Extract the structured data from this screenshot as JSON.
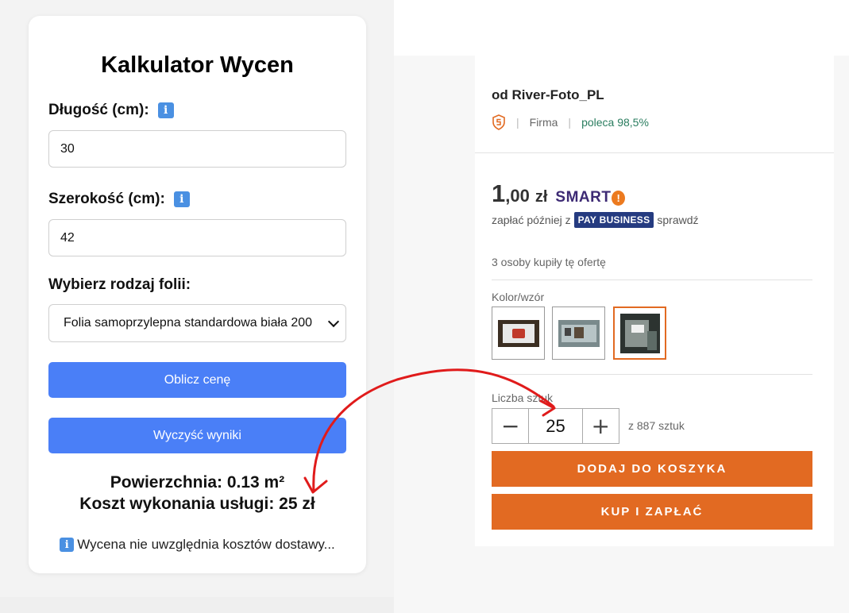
{
  "calculator": {
    "title": "Kalkulator Wycen",
    "length_label": "Długość (cm):",
    "length_value": "30",
    "width_label": "Szerokość (cm):",
    "width_value": "42",
    "film_label": "Wybierz rodzaj folii:",
    "film_selected": "Folia samoprzylepna standardowa biała 200",
    "calc_button": "Oblicz cenę",
    "clear_button": "Wyczyść wyniki",
    "result_area": "Powierzchnia: 0.13 m²",
    "result_cost": "Koszt wykonania usługi: 25 zł",
    "note": "Wycena nie uwzględnia kosztów dostawy...",
    "info_glyph": "i"
  },
  "offer": {
    "seller": "od River-Foto_PL",
    "seller_type": "Firma",
    "recommend": "poleca 98,5%",
    "price_int": "1",
    "price_dec": ",00",
    "currency": "zł",
    "smart_label": "SMART",
    "smart_glyph": "!",
    "paylater_prefix": "zapłać później z",
    "pay_badge": "PAY BUSINESS",
    "paylater_suffix": "sprawdź",
    "bought_count": "3 osoby kupiły tę ofertę",
    "color_label": "Kolor/wzór",
    "qty_label": "Liczba sztuk",
    "qty_minus": "−",
    "qty_value": "25",
    "qty_plus": "+",
    "stock": "z 887 sztuk",
    "add_to_cart": "DODAJ DO KOSZYKA",
    "buy_now": "KUP I ZAPŁAĆ"
  },
  "colors": {
    "blue_button": "#4a7ff7",
    "orange_button": "#e26a22",
    "info_icon": "#4a90e2",
    "annotation_arrow": "#e01b1b"
  }
}
